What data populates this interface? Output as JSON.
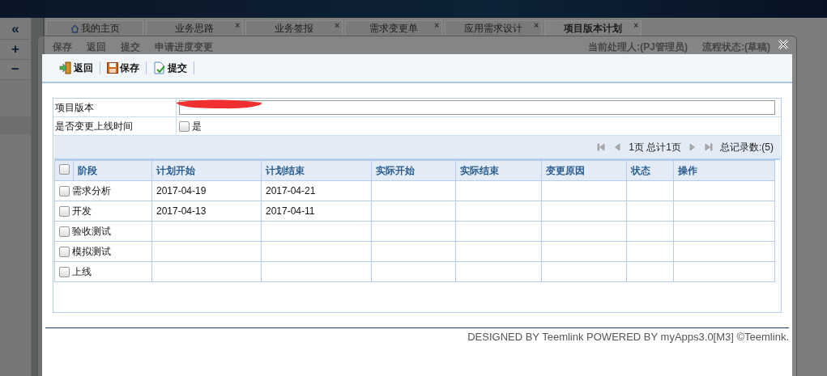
{
  "sidebar": {
    "buttons": [
      "«",
      "+",
      "−"
    ]
  },
  "tabs": [
    {
      "kind": "home",
      "label": "我的主页",
      "selected": false
    },
    {
      "kind": "page",
      "label": "业务思路",
      "selected": false,
      "close": "×"
    },
    {
      "kind": "page",
      "label": "业务签报",
      "selected": false,
      "close": "×"
    },
    {
      "kind": "page",
      "label": "需求变更单",
      "selected": false,
      "close": "×"
    },
    {
      "kind": "page",
      "label": "应用需求设计",
      "selected": false,
      "close": "×"
    },
    {
      "kind": "page",
      "label": "项目版本计划",
      "selected": true,
      "close": "×"
    }
  ],
  "back_toolbar": {
    "buttons": [
      "保存",
      "返回",
      "提交",
      "申请进度变更"
    ],
    "handler": "当前处理人:(PJ管理员)",
    "flow_status": "流程状态:(草稿)"
  },
  "dialog": {
    "toolbar": [
      {
        "kind": "back",
        "label": "返回"
      },
      {
        "kind": "save",
        "label": "保存"
      },
      {
        "kind": "submit",
        "label": "提交"
      }
    ],
    "form": [
      {
        "kind": "text",
        "label": "项目版本",
        "redacted": true
      },
      {
        "kind": "checkbox",
        "label": "是否变更上线时间",
        "option": "是",
        "checked": false
      }
    ],
    "pager": {
      "page": "1页 总计1页",
      "total": "总记录数:(5)"
    },
    "table": {
      "all_checked": false,
      "columns": [
        "阶段",
        "计划开始",
        "计划结束",
        "实际开始",
        "实际结束",
        "变更原因",
        "状态",
        "操作"
      ],
      "rows": [
        {
          "checked": false,
          "phase": "需求分析",
          "plan_start": "2017-04-19",
          "plan_end": "2017-04-21"
        },
        {
          "checked": false,
          "phase": "开发",
          "plan_start": "2017-04-13",
          "plan_end": "2017-04-11"
        },
        {
          "checked": false,
          "phase": "验收测试"
        },
        {
          "checked": false,
          "phase": "模拟测试"
        },
        {
          "checked": false,
          "phase": "上线"
        }
      ]
    },
    "footer": "DESIGNED BY Teemlink POWERED BY myApps3.0[M3] ©Teemlink."
  }
}
